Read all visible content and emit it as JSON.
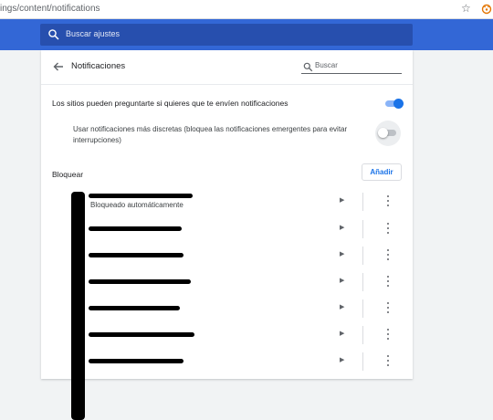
{
  "browser": {
    "url": "ings/content/notifications",
    "bookmark_icon": "star-icon",
    "extension_icon": "extension-icon"
  },
  "header": {
    "search_placeholder": "Buscar ajustes",
    "accent_color": "#3367d6"
  },
  "panel": {
    "title": "Notificaciones",
    "search_placeholder": "Buscar",
    "ask_label": "Los sitios pueden preguntarte si quieres que te envíen notificaciones",
    "ask_enabled": true,
    "quiet_label": "Usar notificaciones más discretas (bloquea las notificaciones emergentes para evitar interrupciones)",
    "quiet_enabled": false,
    "block_section": {
      "title": "Bloquear",
      "add_label": "Añadir",
      "rows": [
        {
          "subtitle": "Bloqueado automáticamente"
        },
        {
          "subtitle": ""
        },
        {
          "subtitle": ""
        },
        {
          "subtitle": ""
        },
        {
          "subtitle": ""
        },
        {
          "subtitle": ""
        },
        {
          "subtitle": ""
        }
      ]
    }
  }
}
